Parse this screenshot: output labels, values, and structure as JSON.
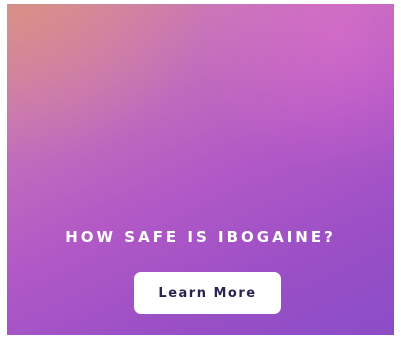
{
  "ad": {
    "headline": "HOW SAFE IS IBOGAINE?",
    "cta_label": "Learn More",
    "colors": {
      "gradient_start": "#d6889a",
      "gradient_mid": "#b259c6",
      "gradient_end": "#8a4dc6",
      "button_bg": "#ffffff",
      "button_text": "#2a2450"
    }
  }
}
